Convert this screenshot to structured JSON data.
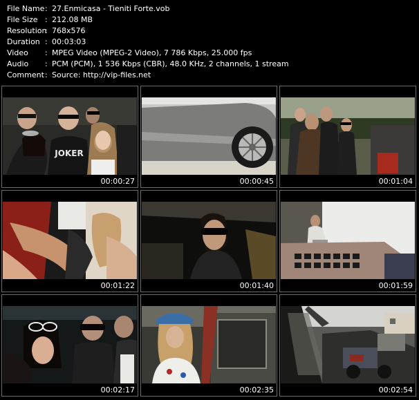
{
  "file_info": [
    {
      "label": "File Name",
      "value": "27.Enmicasa - Tieniti Forte.vob"
    },
    {
      "label": "File Size",
      "value": "212.08 MB"
    },
    {
      "label": "Resolution",
      "value": "768x576"
    },
    {
      "label": "Duration",
      "value": "00:03:03"
    },
    {
      "label": "Video",
      "value": "MPEG Video (MPEG-2 Video), 7 786 Kbps, 25.000 fps"
    },
    {
      "label": "Audio",
      "value": "PCM (PCM), 1 536 Kbps (CBR), 48.0 KHz, 2 channels, 1 stream"
    },
    {
      "label": "Comment",
      "value": "Source: http://vip-files.net"
    }
  ],
  "separator": ":",
  "thumbnails": [
    {
      "time": "00:00:27",
      "scene": "group-portrait-joker-shirt",
      "overlay_text": "JOKER"
    },
    {
      "time": "00:00:45",
      "scene": "car-wheel-closeup"
    },
    {
      "time": "00:01:04",
      "scene": "men-at-scrapyard"
    },
    {
      "time": "00:01:22",
      "scene": "dancers-closeup"
    },
    {
      "time": "00:01:40",
      "scene": "singer-sunglasses"
    },
    {
      "time": "00:01:59",
      "scene": "man-on-car-roof"
    },
    {
      "time": "00:02:17",
      "scene": "group-with-sunglasses"
    },
    {
      "time": "00:02:35",
      "scene": "woman-blue-helmet"
    },
    {
      "time": "00:02:54",
      "scene": "scrapyard-cars"
    }
  ]
}
